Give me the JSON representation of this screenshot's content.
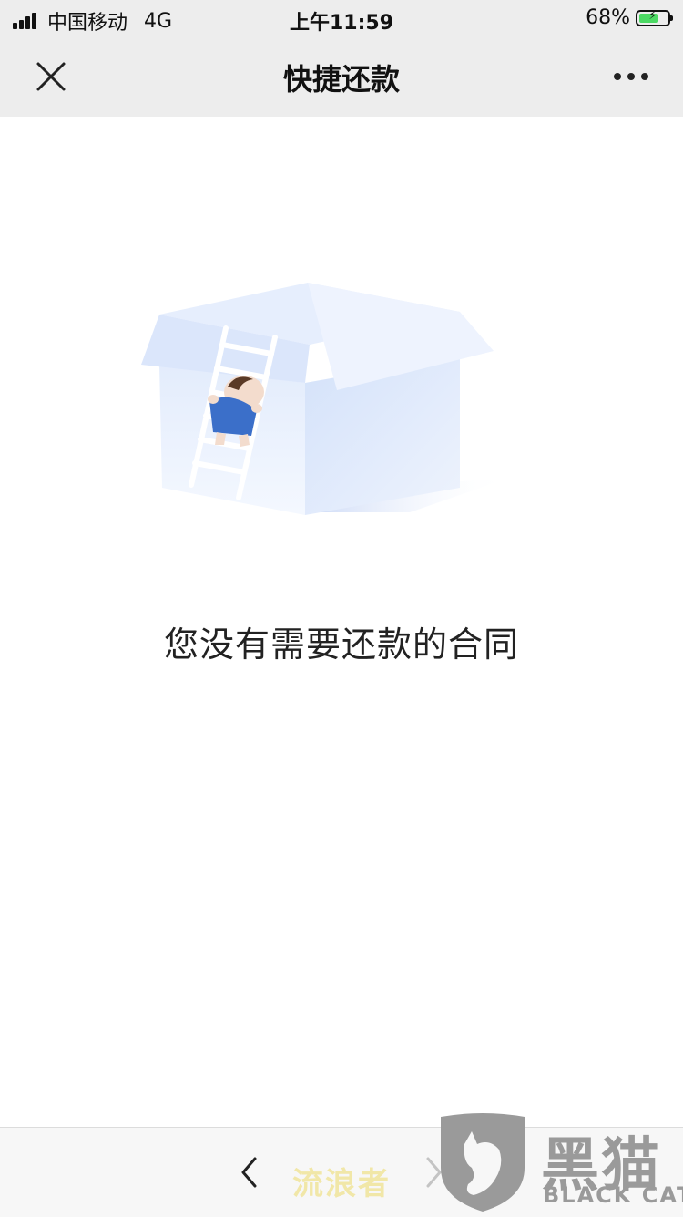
{
  "status_bar": {
    "carrier": "中国移动",
    "network": "4G",
    "time": "上午11:59",
    "battery_percent": "68%",
    "battery_level": 0.68
  },
  "nav": {
    "title": "快捷还款",
    "close_icon": "close-icon",
    "more_icon": "more-icon"
  },
  "main": {
    "illustration": "empty-box-illustration",
    "empty_message": "您没有需要还款的合同"
  },
  "bottom_bar": {
    "back_icon": "chevron-left-icon",
    "forward_icon": "chevron-right-icon",
    "watermark_text": "流浪者",
    "logo_cn": "黑猫",
    "logo_en": "BLACK CAT"
  },
  "colors": {
    "bar_bg": "#ededed",
    "battery_green": "#4cd964",
    "box_blue": "#dce8fb",
    "shirt_blue": "#3b6fc9"
  }
}
